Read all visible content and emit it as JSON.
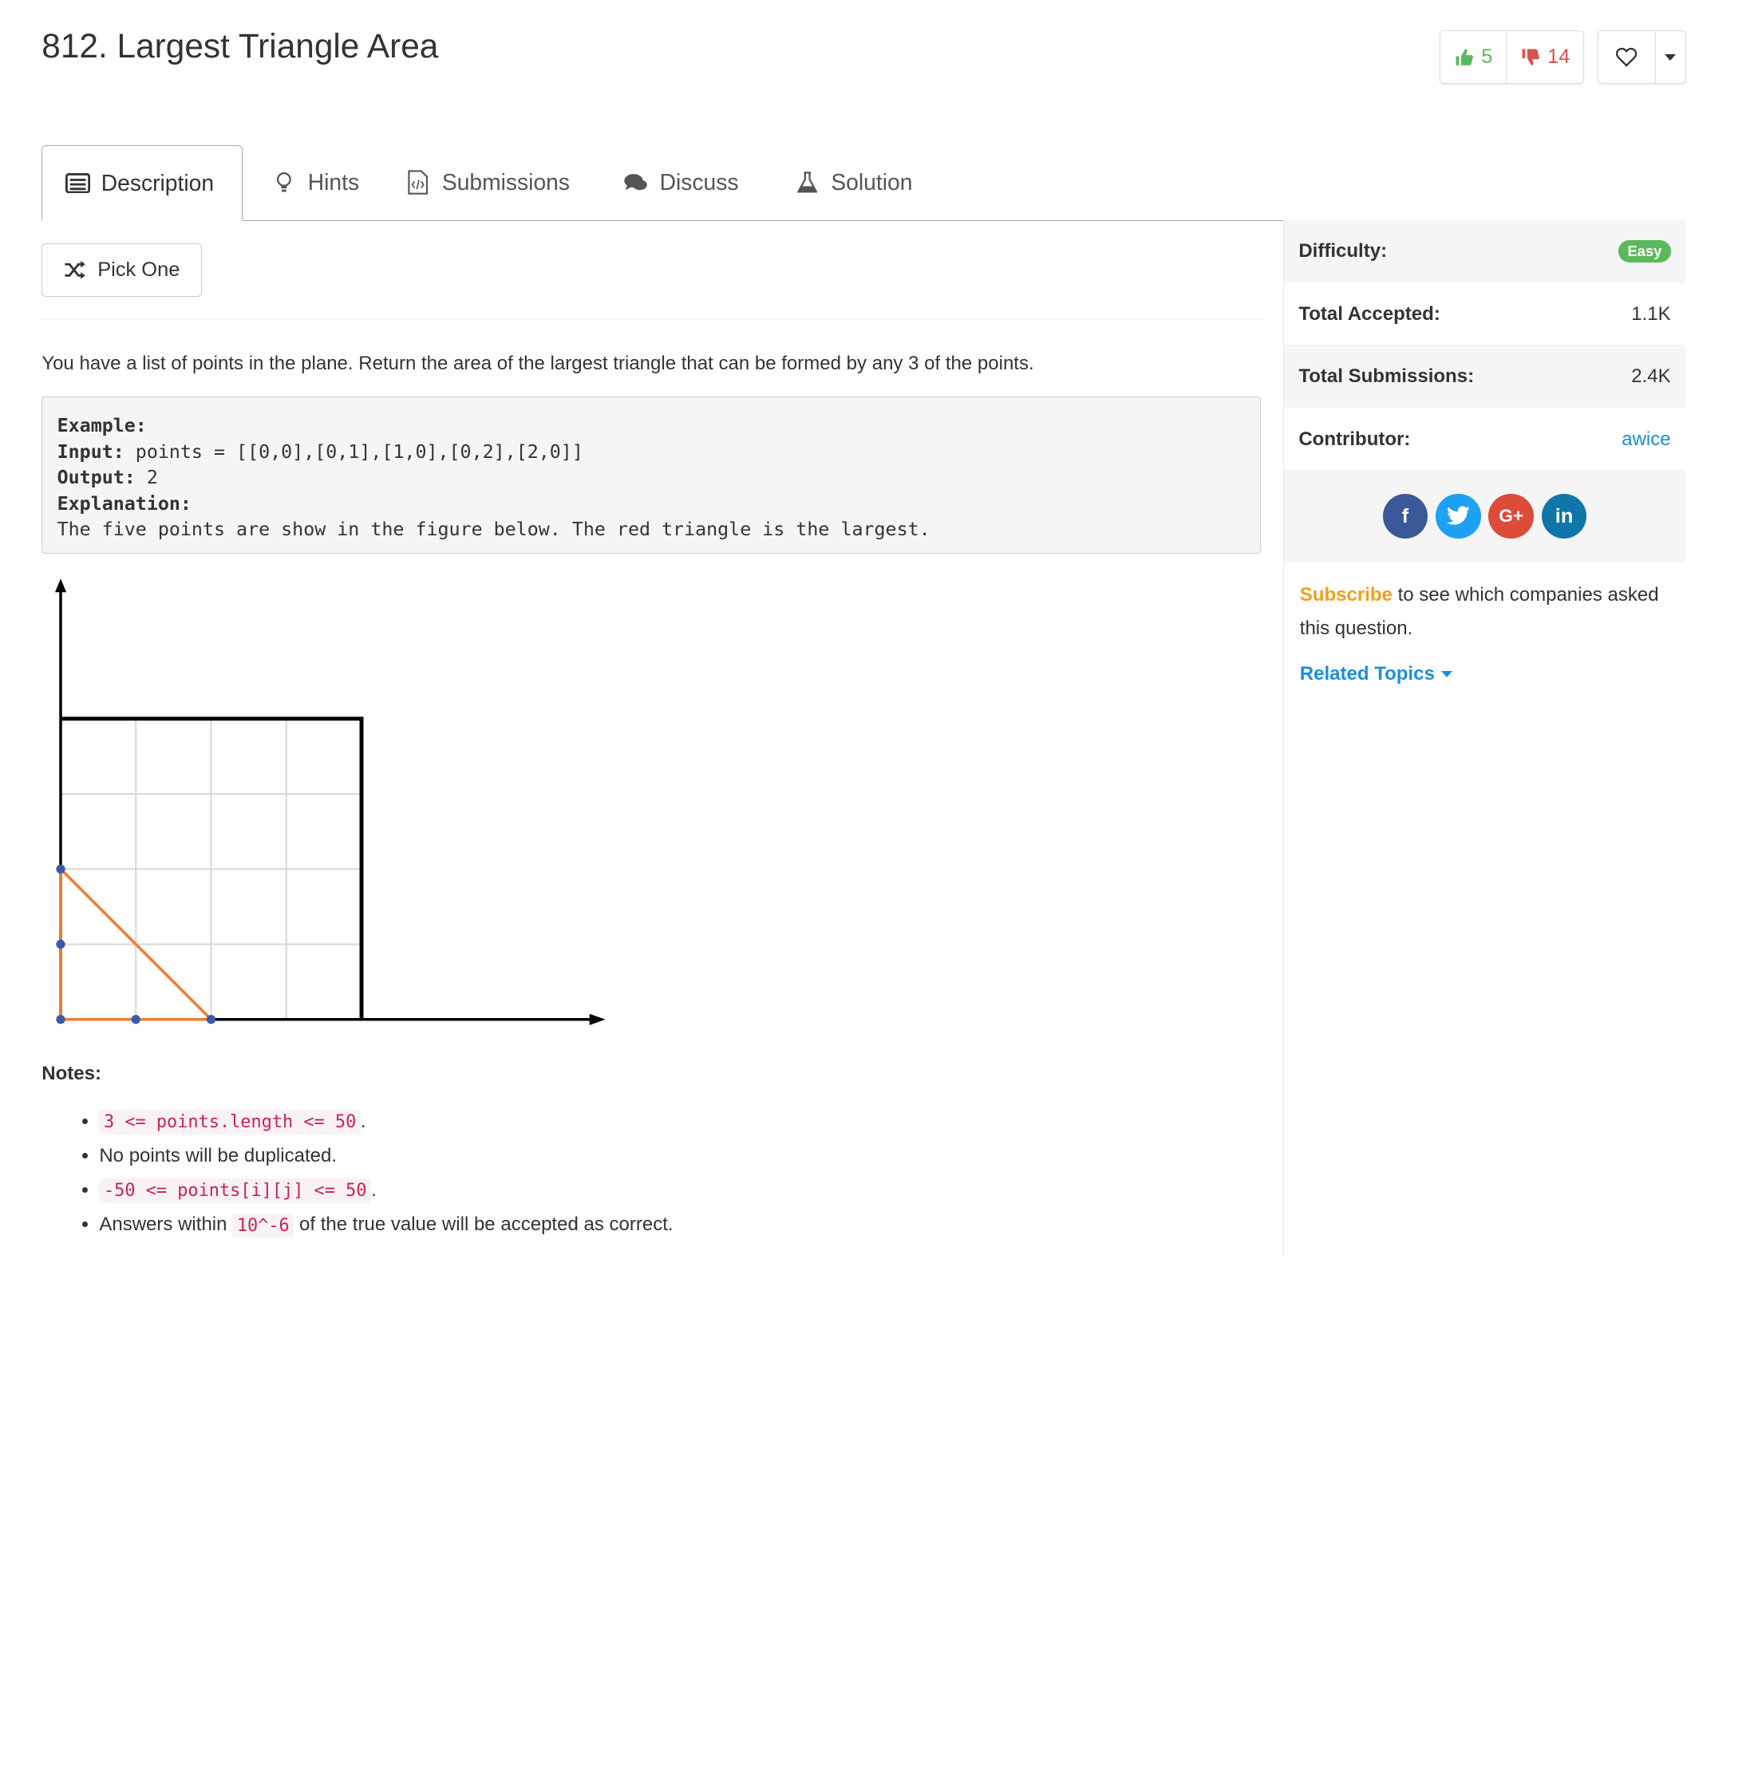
{
  "problem": {
    "title": "812. Largest Triangle Area",
    "likes": "5",
    "dislikes": "14",
    "description": "You have a list of points in the plane. Return the area of the largest triangle that can be formed by any 3 of the points."
  },
  "tabs": [
    {
      "label": "Description"
    },
    {
      "label": "Hints"
    },
    {
      "label": "Submissions"
    },
    {
      "label": "Discuss"
    },
    {
      "label": "Solution"
    }
  ],
  "pick_one_label": "Pick One",
  "example": {
    "heading": "Example:",
    "input_label": "Input:",
    "input_value": " points = [[0,0],[0,1],[1,0],[0,2],[2,0]]",
    "output_label": "Output:",
    "output_value": " 2",
    "explanation_label": "Explanation:",
    "explanation_text": "The five points are show in the figure below. The red triangle is the largest."
  },
  "figure": {
    "points": [
      [
        0,
        0
      ],
      [
        0,
        1
      ],
      [
        1,
        0
      ],
      [
        0,
        2
      ],
      [
        2,
        0
      ]
    ],
    "triangle": [
      [
        0,
        0
      ],
      [
        0,
        2
      ],
      [
        2,
        0
      ]
    ],
    "grid_range": [
      0,
      4
    ],
    "colors": {
      "axis": "#000000",
      "grid": "#d9d9d9",
      "triangle": "#ee7d30",
      "point": "#3b5ba8"
    }
  },
  "notes": {
    "title": "Notes:",
    "items": [
      {
        "code": "3 <= points.length <= 50",
        "suffix": "."
      },
      {
        "text": "No points will be duplicated."
      },
      {
        "code": "-50 <= points[i][j] <= 50",
        "suffix": "."
      },
      {
        "prefix": "Answers within ",
        "code": "10^-6",
        "suffix": " of the true value will be accepted as correct."
      }
    ]
  },
  "sidebar": {
    "difficulty_label": "Difficulty:",
    "difficulty_value": "Easy",
    "accepted_label": "Total Accepted:",
    "accepted_value": "1.1K",
    "submissions_label": "Total Submissions:",
    "submissions_value": "2.4K",
    "contributor_label": "Contributor:",
    "contributor_value": "awice",
    "social": [
      {
        "name": "facebook",
        "glyph": "f",
        "color": "#3b5998"
      },
      {
        "name": "twitter",
        "glyph": "t",
        "color": "#1da1f2"
      },
      {
        "name": "google-plus",
        "glyph": "G+",
        "color": "#dd4b39"
      },
      {
        "name": "linkedin",
        "glyph": "in",
        "color": "#0e76a8"
      }
    ],
    "subscribe_link": "Subscribe",
    "subscribe_text": " to see which companies asked this question.",
    "related_topics": "Related Topics"
  },
  "colors": {
    "accent": "#1a8fd6",
    "easy": "#5cb85c",
    "like": "#5cb85c",
    "dislike": "#d9534f",
    "subscribe": "#f0a01e"
  }
}
